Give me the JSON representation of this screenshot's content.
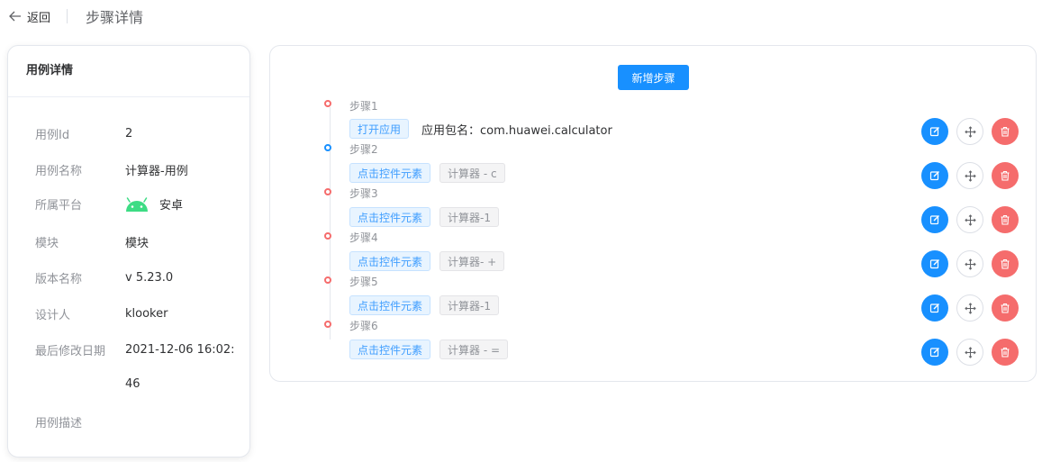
{
  "header": {
    "back_label": "返回",
    "title": "步骤详情"
  },
  "case_info": {
    "title": "用例详情",
    "fields": [
      {
        "label": "用例Id",
        "value": "2"
      },
      {
        "label": "用例名称",
        "value": "计算器-用例"
      },
      {
        "label": "所属平台",
        "value": "安卓",
        "icon": "android-icon"
      },
      {
        "label": "模块",
        "value": "模块"
      },
      {
        "label": "版本名称",
        "value": "v 5.23.0"
      },
      {
        "label": "设计人",
        "value": "klooker"
      },
      {
        "label": "最后修改日期",
        "value": "2021-12-06 16:02:",
        "value_cont": "46"
      },
      {
        "label": "用例描述",
        "value": ""
      }
    ]
  },
  "steps": {
    "add_label": "新增步骤",
    "items": [
      {
        "title": "步骤1",
        "action": "打开应用",
        "target": "应用包名：com.huawei.calculator",
        "dot_color": "#f56c6c"
      },
      {
        "title": "步骤2",
        "action": "点击控件元素",
        "target": "计算器 - c",
        "dot_color": "#1890ff"
      },
      {
        "title": "步骤3",
        "action": "点击控件元素",
        "target": "计算器-1",
        "dot_color": "#f56c6c"
      },
      {
        "title": "步骤4",
        "action": "点击控件元素",
        "target": "计算器- +",
        "dot_color": "#f56c6c"
      },
      {
        "title": "步骤5",
        "action": "点击控件元素",
        "target": "计算器-1",
        "dot_color": "#f56c6c"
      },
      {
        "title": "步骤6",
        "action": "点击控件元素",
        "target": "计算器 - =",
        "dot_color": "#f56c6c"
      }
    ],
    "action_icons": [
      "edit-icon",
      "move-icon",
      "delete-icon"
    ]
  },
  "colors": {
    "primary": "#1890ff",
    "danger": "#f56c6c"
  }
}
